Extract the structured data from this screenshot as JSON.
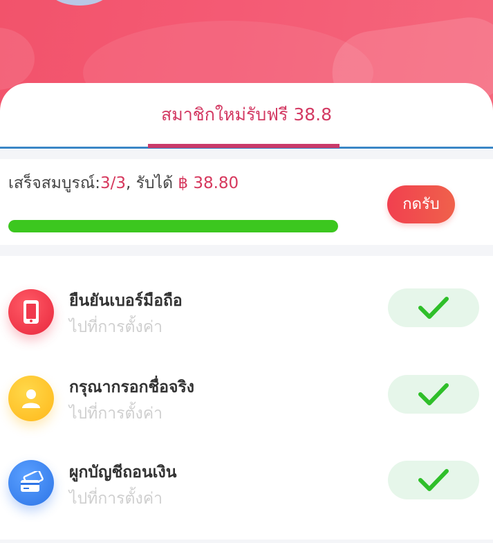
{
  "header": {
    "tab_title": "สมาชิกใหม่รับฟรี 38.8"
  },
  "progress": {
    "label": "เสร็จสมบูรณ์:",
    "count": "3/3",
    "reward_label": ", รับได้",
    "reward_amount": "฿ 38.80",
    "fraction": 1.0,
    "claim_button": "กดรับ"
  },
  "tasks": [
    {
      "title": "ยืนยันเบอร์มือถือ",
      "subtitle": "ไปที่การตั้งค่า",
      "icon": "phone-icon",
      "color": "#f23a4f",
      "completed": true
    },
    {
      "title": "กรุณากรอกชื่อจริง",
      "subtitle": "ไปที่การตั้งค่า",
      "icon": "user-icon",
      "color": "#ffc01e",
      "completed": true
    },
    {
      "title": "ผูกบัญชีถอนเงิน",
      "subtitle": "ไปที่การตั้งค่า",
      "icon": "bank-card-icon",
      "color": "#3b86f0",
      "completed": true
    }
  ],
  "colors": {
    "accent": "#d33a63",
    "progress": "#3cc71f",
    "check": "#2fbf2a"
  }
}
